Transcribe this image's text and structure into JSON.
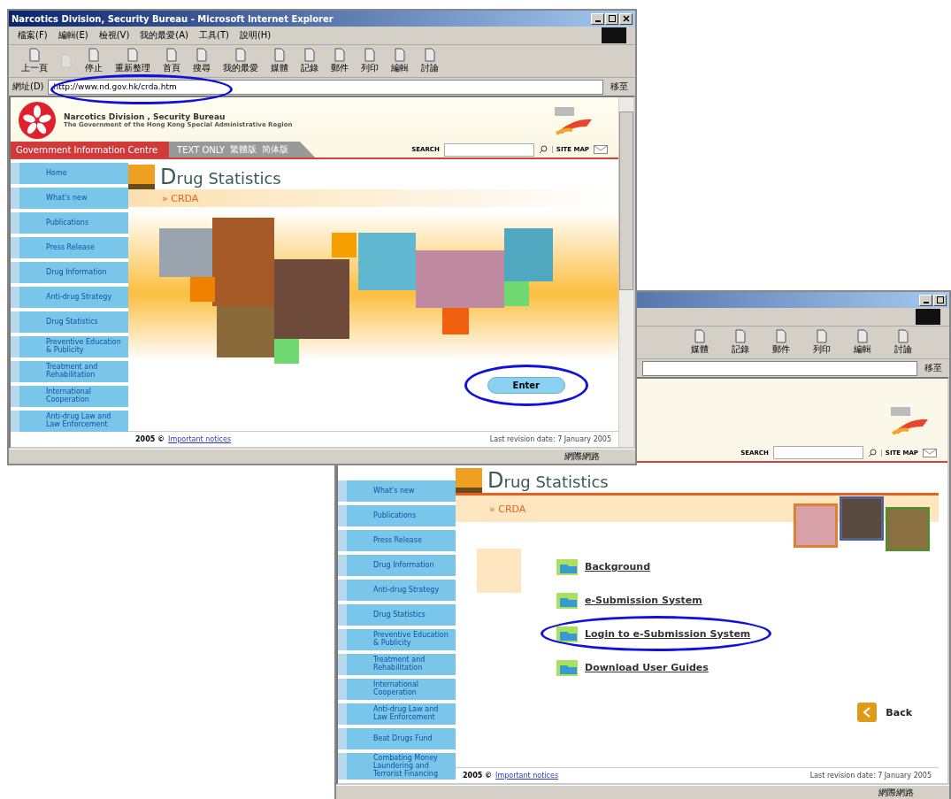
{
  "front_window": {
    "title": "Narcotics Division, Security Bureau - Microsoft Internet Explorer",
    "menu": [
      "檔案(F)",
      "編輯(E)",
      "檢視(V)",
      "我的最愛(A)",
      "工具(T)",
      "說明(H)"
    ],
    "toolbar": [
      {
        "label": "上一頁",
        "disabled": false
      },
      {
        "disabled": true
      },
      {
        "label": "停止",
        "disabled": false
      },
      {
        "label": "重新整理",
        "disabled": false
      },
      {
        "label": "首頁",
        "disabled": false
      },
      {
        "label": "搜尋",
        "disabled": false
      },
      {
        "label": "我的最愛",
        "disabled": false
      },
      {
        "label": "媒體",
        "disabled": false
      },
      {
        "label": "記錄",
        "disabled": false
      },
      {
        "label": "郵件",
        "disabled": false
      },
      {
        "label": "列印",
        "disabled": false
      },
      {
        "label": "編輯",
        "disabled": false
      },
      {
        "label": "討論",
        "disabled": false
      }
    ],
    "address": {
      "label": "網址(D)",
      "value": "http://www.nd.gov.hk/crda.htm"
    },
    "go_button": "移至",
    "site": {
      "agency": "Narcotics Division , Security Bureau",
      "government": "The Government of the Hong Kong Special Administrative Region",
      "nav": [
        "Government Information Centre",
        "TEXT ONLY",
        "繁體版",
        "简体版"
      ],
      "search_label": "SEARCH",
      "site_map": "SITE MAP"
    },
    "sidebar": [
      "Home",
      "What's new",
      "Publications",
      "Press Release",
      "Drug Information",
      "Anti-drug Strategy",
      "Drug Statistics",
      "Preventive Education & Publicity",
      "Treatment and Rehabilitation",
      "International Cooperation",
      "Anti-drug Law and Law Enforcement"
    ],
    "heading": "Drug Statistics",
    "section": "» CRDA",
    "enter_button": "Enter",
    "footer": {
      "year": "2005 ©",
      "notices_link": "Important notices",
      "revision": "Last revision date: 7 January 2005"
    },
    "status": "網際網路"
  },
  "back_window": {
    "toolbar": [
      "媒體",
      "記錄",
      "郵件",
      "列印",
      "編輯",
      "討論"
    ],
    "go_button": "移至",
    "site": {
      "search_label": "SEARCH",
      "site_map": "SITE MAP"
    },
    "sidebar": [
      "What's new",
      "Publications",
      "Press Release",
      "Drug Information",
      "Anti-drug Strategy",
      "Drug Statistics",
      "Preventive Education & Publicity",
      "Treatment and Rehabilitation",
      "International Cooperation",
      "Anti-drug Law and Law Enforcement",
      "Beat Drugs Fund",
      "Combating Money Laundering and Terrorist Financing"
    ],
    "heading": "Drug Statistics",
    "section": "» CRDA",
    "links": [
      {
        "label": "Background",
        "circled": false
      },
      {
        "label": "e-Submission System",
        "circled": false
      },
      {
        "label": "Login to e-Submission System",
        "circled": true
      },
      {
        "label": "Download User Guides",
        "circled": false
      }
    ],
    "back_button": "Back",
    "footer": {
      "year": "2005 ©",
      "notices_link": "Important notices",
      "revision": "Last revision date: 7 January 2005"
    },
    "status": "網際網路"
  }
}
